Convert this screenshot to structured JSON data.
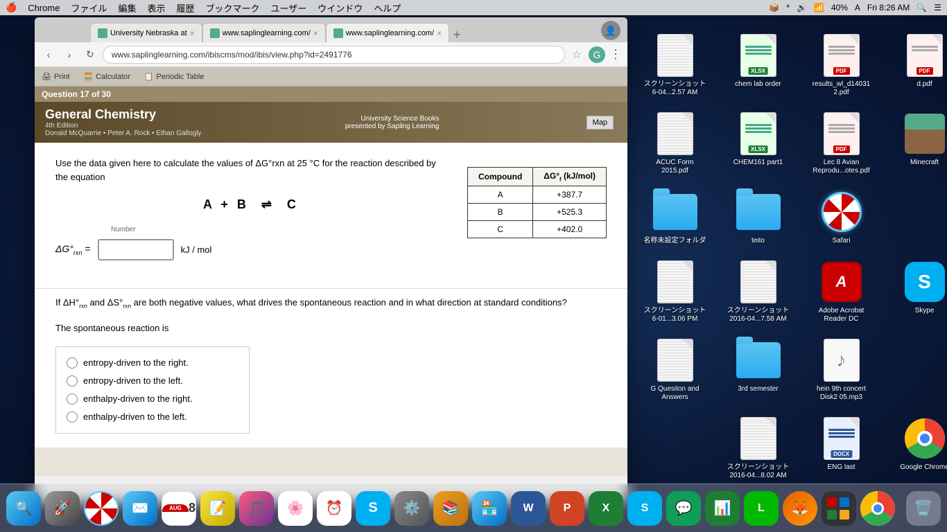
{
  "menubar": {
    "apple": "🍎",
    "chrome": "Chrome",
    "items": [
      "ファイル",
      "編集",
      "表示",
      "履歴",
      "ブックマーク",
      "ユーザー",
      "ウインドウ",
      "ヘルプ"
    ],
    "time": "Fri 8:26 AM",
    "battery": "40%"
  },
  "browser": {
    "tabs": [
      {
        "title": "University Nebraska at",
        "url": "",
        "active": true,
        "favicon_color": "#5a8"
      },
      {
        "title": "www.saplinglearning.com/",
        "url": "",
        "active": false,
        "favicon_color": "#5a8"
      },
      {
        "title": "www.saplinglearning.com/",
        "url": "",
        "active": true,
        "favicon_color": "#5a8"
      }
    ],
    "address": "www.saplinglearning.com/ibiscms/mod/ibis/view.php?id=2491776",
    "subtoolbar": {
      "items": [
        "Print",
        "Calculator",
        "Periodic Table"
      ]
    }
  },
  "question": {
    "number": "Question 17 of 30",
    "textbook_title": "General Chemistry",
    "textbook_edition": "4th Edition",
    "textbook_authors": "Donald McQuarrie • Peter A. Rock • Ethan Gallogly",
    "textbook_publisher": "University Science Books",
    "textbook_presented": "presented by Sapling Learning",
    "question_text": "Use the data given here to calculate the values of ΔG°rxn at 25 °C for the reaction described by the equation",
    "equation": "A + B ⇌ C",
    "number_label": "Number",
    "kj_mol": "kJ / mol",
    "delta_g_label": "ΔG°rxn =",
    "table": {
      "headers": [
        "Compound",
        "ΔG°f (kJ/mol)"
      ],
      "rows": [
        {
          "compound": "A",
          "value": "+387.7"
        },
        {
          "compound": "B",
          "value": "+525.3"
        },
        {
          "compound": "C",
          "value": "+402.0"
        }
      ]
    },
    "second_question_text": "If ΔH°rxn and ΔS°rxn are both negative values, what drives the spontaneous reaction and in what direction at standard conditions?",
    "spontaneous_text": "The spontaneous reaction is",
    "options": [
      "entropy-driven to the right.",
      "entropy-driven to the left.",
      "enthalpy-driven to the right.",
      "enthalpy-driven to the left."
    ],
    "map_btn": "Map"
  },
  "desktop_icons": [
    {
      "name": "screenshot-1",
      "label": "スクリーンショット\n6-04...2.57 AM",
      "type": "screenshot"
    },
    {
      "name": "chem-lab-order",
      "label": "chem lab order",
      "type": "xlsx"
    },
    {
      "name": "results-pdf",
      "label": "results_wl_d14031\n2.pdf",
      "type": "pdf"
    },
    {
      "name": "d-pdf",
      "label": "d.pdf",
      "type": "pdf"
    },
    {
      "name": "acuc-form",
      "label": "ACUC Form\n2015.pdf",
      "type": "screenshot"
    },
    {
      "name": "chem161-part1",
      "label": "CHEM161 part1",
      "type": "xlsx"
    },
    {
      "name": "lec8-avian",
      "label": "Lec 8 Avian\nReprodu...otes.pdf",
      "type": "pdf"
    },
    {
      "name": "minecraft",
      "label": "Minecraft",
      "type": "minecraft"
    },
    {
      "name": "unnamed-folder",
      "label": "名称未設定フォルダ",
      "type": "folder"
    },
    {
      "name": "teito-folder",
      "label": "teito",
      "type": "folder"
    },
    {
      "name": "safari",
      "label": "Safari",
      "type": "safari"
    },
    {
      "name": "screenshot-2",
      "label": "スクリーンショット\n6-01...3.06 PM",
      "type": "screenshot"
    },
    {
      "name": "screenshot-3",
      "label": "スクリーンショット\n2016-04...7.58 AM",
      "type": "screenshot"
    },
    {
      "name": "adobe-acrobat",
      "label": "Adobe Acrobat\nReader DC",
      "type": "acrobat"
    },
    {
      "name": "skype",
      "label": "Skype",
      "type": "skype"
    },
    {
      "name": "g-quesiton",
      "label": "G Quesiton and\nAnswers",
      "type": "screenshot"
    },
    {
      "name": "3rd-semester",
      "label": "3rd semester",
      "type": "folder"
    },
    {
      "name": "hein-concert",
      "label": "hein 9th concert\nDisk2   05.mp3",
      "type": "music"
    },
    {
      "name": "screenshot-4",
      "label": "スクリーンショット\n2016-04...8.02 AM",
      "type": "screenshot"
    },
    {
      "name": "eng-last",
      "label": "ENG last",
      "type": "docx"
    },
    {
      "name": "google-chrome",
      "label": "Google Chrome",
      "type": "chrome"
    }
  ],
  "dock": {
    "items": [
      "🔍",
      "🚀",
      "📧",
      "📅",
      "📝",
      "🎵",
      "🖼",
      "⏰",
      "💬",
      "⚙️",
      "📚",
      "🏪",
      "W",
      "P",
      "X",
      "S",
      "💬",
      "📊",
      "L",
      "🦊",
      "📱",
      "🌐",
      "🧮",
      "🗑"
    ]
  }
}
